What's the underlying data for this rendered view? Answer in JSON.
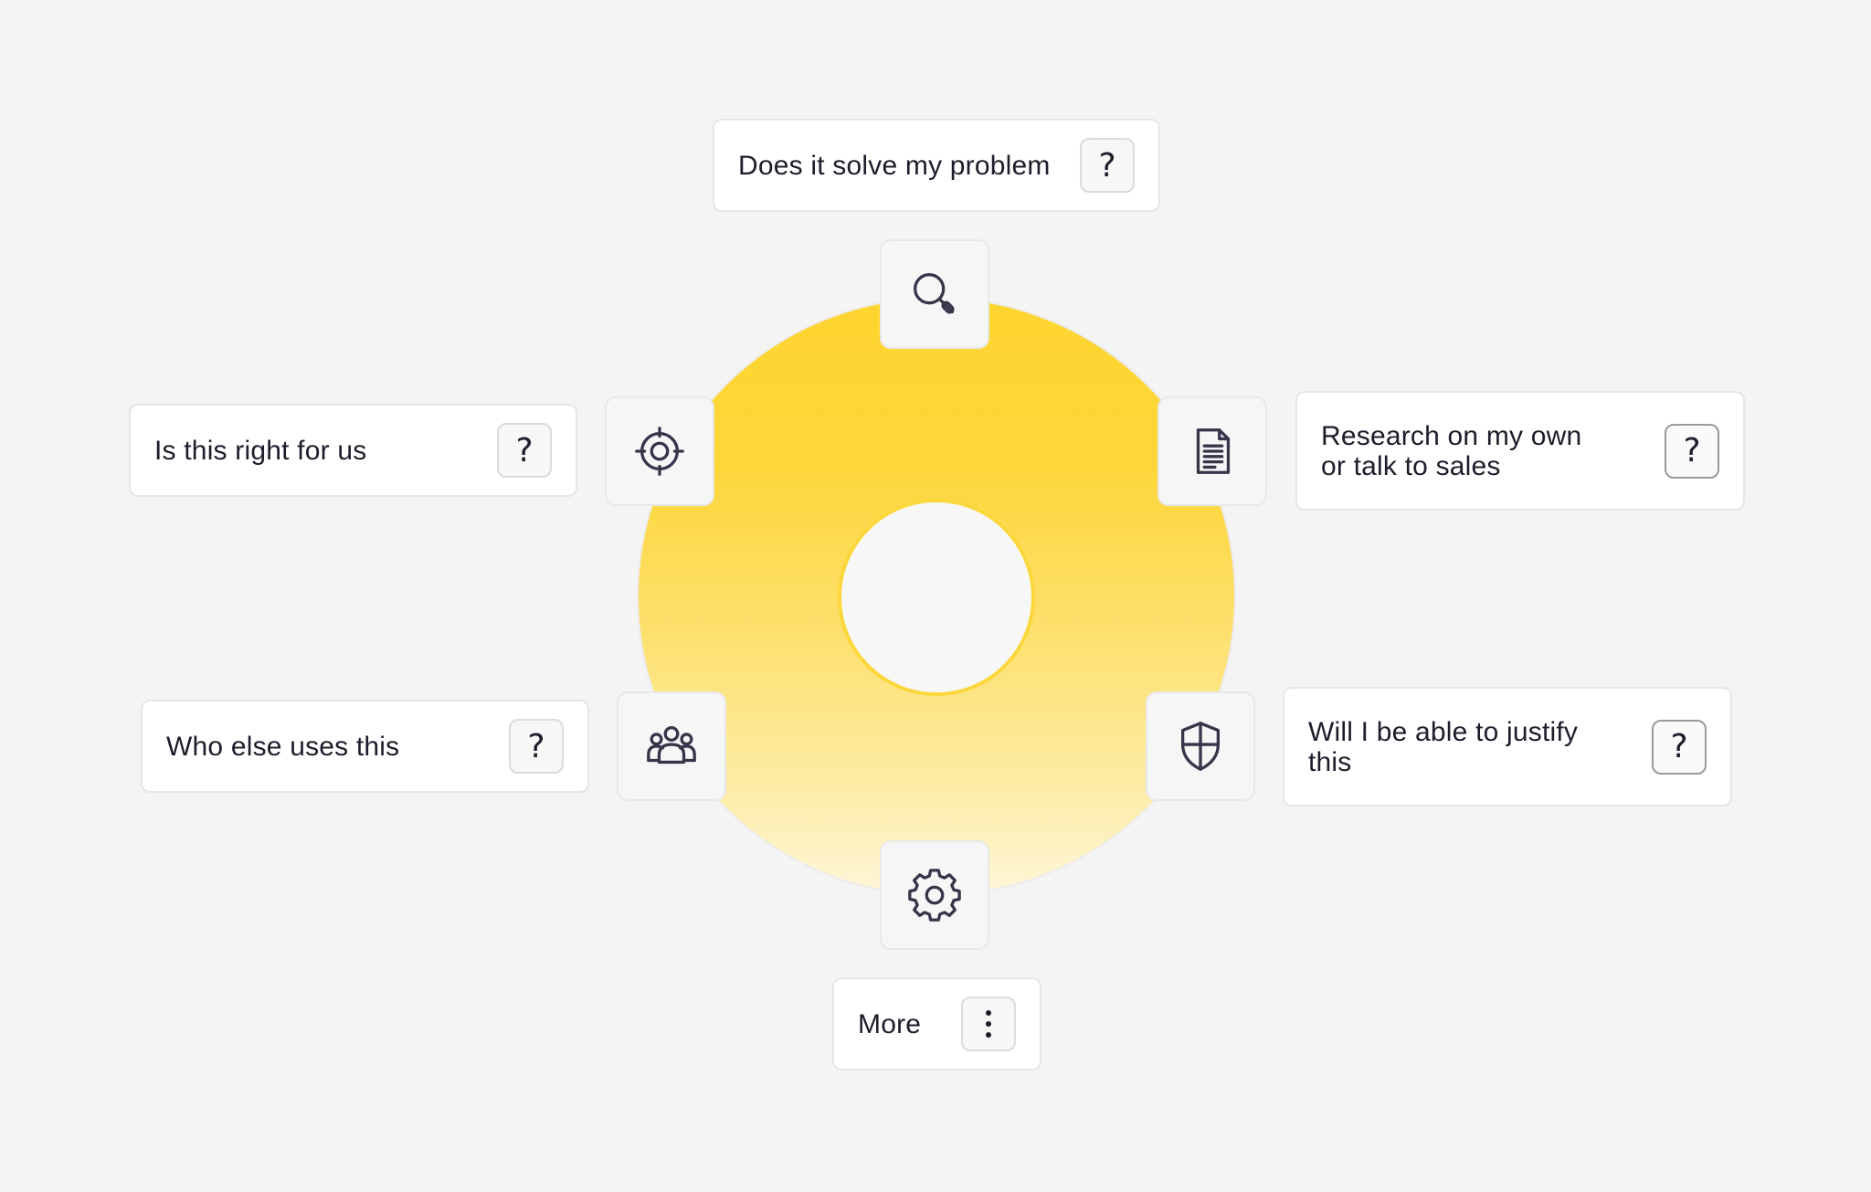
{
  "colors": {
    "ring_top": "#fed52f",
    "ring_bottom": "#fef6d8",
    "hub": "#f7f7f7",
    "hub_border": "#fcd73b",
    "background": "#f4f4f4",
    "text": "#1d1d2b"
  },
  "center": {
    "icons": [
      "search-icon",
      "target-icon",
      "document-icon",
      "people-icon",
      "shield-icon",
      "gear-icon"
    ]
  },
  "cards": {
    "top": {
      "label": "Does it solve my problem",
      "action": "?"
    },
    "upper_left": {
      "label": "Is this right for us",
      "action": "?"
    },
    "upper_right": {
      "line1": "Research on my own",
      "line2": "or talk to sales",
      "action": "?"
    },
    "lower_left": {
      "label": "Who else uses this",
      "action": "?"
    },
    "lower_right": {
      "line1": "Will I be able to justify",
      "line2": "this",
      "action": "?"
    },
    "bottom": {
      "label": "More",
      "action_icon": "more-vertical-icon"
    }
  }
}
